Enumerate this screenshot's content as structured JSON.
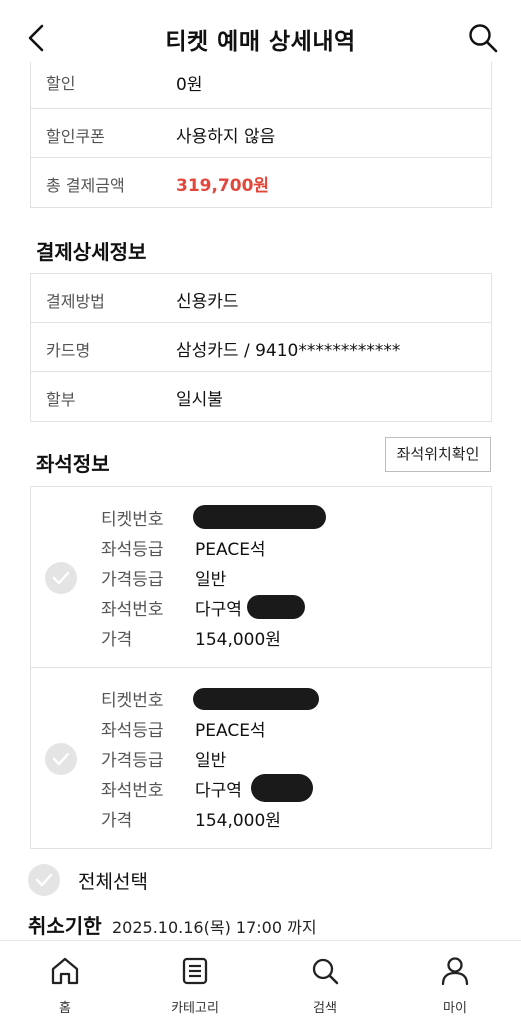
{
  "header": {
    "title": "티켓 예매 상세내역",
    "back_icon": "chevron-left-icon",
    "search_icon": "search-icon"
  },
  "payment_summary": [
    {
      "label": "할인",
      "value": "0원"
    },
    {
      "label": "할인쿠폰",
      "value": "사용하지 않음"
    },
    {
      "label": "총 결제금액",
      "value": "319,700원"
    }
  ],
  "payment_detail": {
    "title": "결제상세정보",
    "rows": [
      {
        "label": "결제방법",
        "value": "신용카드"
      },
      {
        "label": "카드명",
        "value": "삼성카드 / 9410************"
      },
      {
        "label": "할부",
        "value": "일시불"
      }
    ]
  },
  "seat_info": {
    "title": "좌석정보",
    "location_button": "좌석위치확인",
    "tickets": [
      {
        "ticket_no_label": "티켓번호",
        "grade_label": "좌석등급",
        "grade": "PEACE석",
        "price_grade_label": "가격등급",
        "price_grade": "일반",
        "seat_no_label": "좌석번호",
        "seat_no": "다구역",
        "price_label": "가격",
        "price": "154,000원"
      },
      {
        "ticket_no_label": "티켓번호",
        "grade_label": "좌석등급",
        "grade": "PEACE석",
        "price_grade_label": "가격등급",
        "price_grade": "일반",
        "seat_no_label": "좌석번호",
        "seat_no": "다구역",
        "price_label": "가격",
        "price": "154,000원"
      }
    ]
  },
  "select_all": "전체선택",
  "cancel": {
    "title": "취소기한",
    "deadline": "2025.10.16(목) 17:00 까지"
  },
  "tabbar": [
    {
      "label": "홈",
      "icon": "home-icon"
    },
    {
      "label": "카테고리",
      "icon": "list-icon"
    },
    {
      "label": "검색",
      "icon": "search-icon"
    },
    {
      "label": "마이",
      "icon": "user-icon"
    }
  ],
  "colors": {
    "accent_red": "#e2473c",
    "border": "#e2e2e2",
    "check_gray": "#e4e4e4"
  }
}
